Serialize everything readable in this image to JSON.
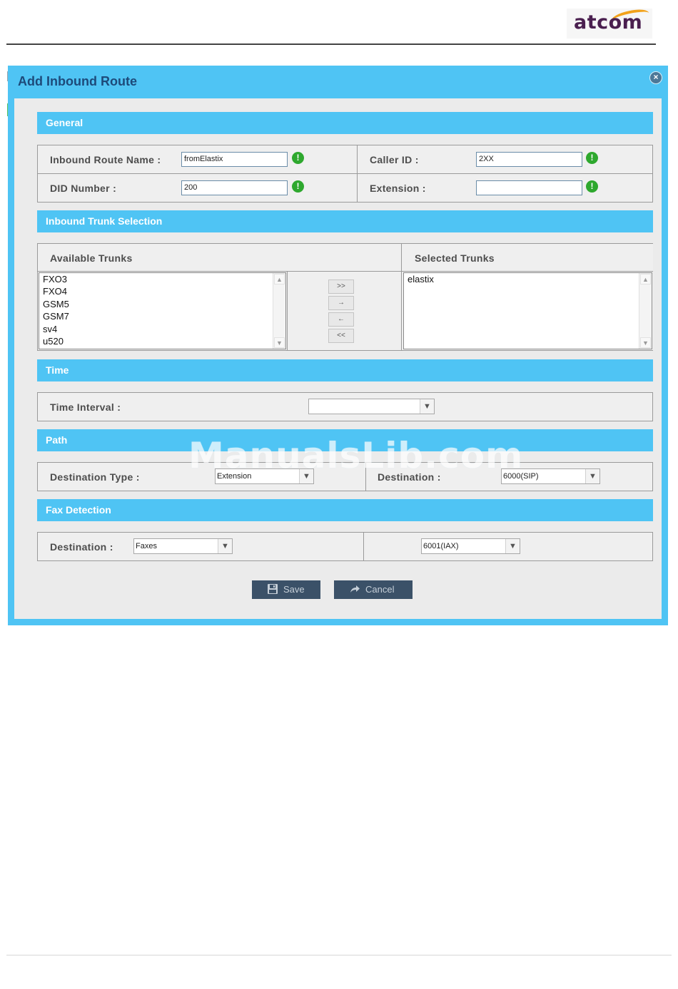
{
  "header": {
    "logo_text": "atcom"
  },
  "dialog": {
    "title": "Add Inbound Route",
    "close_icon": "close-icon",
    "sections": {
      "general": "General",
      "trunk_selection": "Inbound Trunk Selection",
      "time": "Time",
      "path": "Path",
      "fax": "Fax Detection"
    },
    "general": {
      "route_name_label": "Inbound Route Name :",
      "route_name_value": "fromElastix",
      "caller_id_label": "Caller ID :",
      "caller_id_value": "2XX",
      "did_label": "DID Number :",
      "did_value": "200",
      "extension_label": "Extension :",
      "extension_value": "",
      "required_mark": "!"
    },
    "trunks": {
      "available_label": "Available Trunks",
      "selected_label": "Selected Trunks",
      "available": [
        "FXO3",
        "FXO4",
        "GSM5",
        "GSM7",
        "sv4",
        "u520"
      ],
      "selected": [
        "elastix"
      ],
      "buttons": [
        ">>",
        "→",
        "←",
        "<<"
      ]
    },
    "time": {
      "interval_label": "Time Interval :",
      "interval_value": ""
    },
    "path": {
      "dest_type_label": "Destination Type :",
      "dest_type_value": "Extension",
      "destination_label": "Destination :",
      "destination_value": "6000(SIP)"
    },
    "fax": {
      "destination_label": "Destination :",
      "destination_value": "Faxes",
      "target_value": "6001(IAX)"
    },
    "actions": {
      "save": "Save",
      "cancel": "Cancel"
    }
  },
  "watermark": "ManualsLib.com",
  "colors": {
    "accent": "#4fc4f4",
    "button": "#3b5168",
    "required": "#2ea82e"
  }
}
